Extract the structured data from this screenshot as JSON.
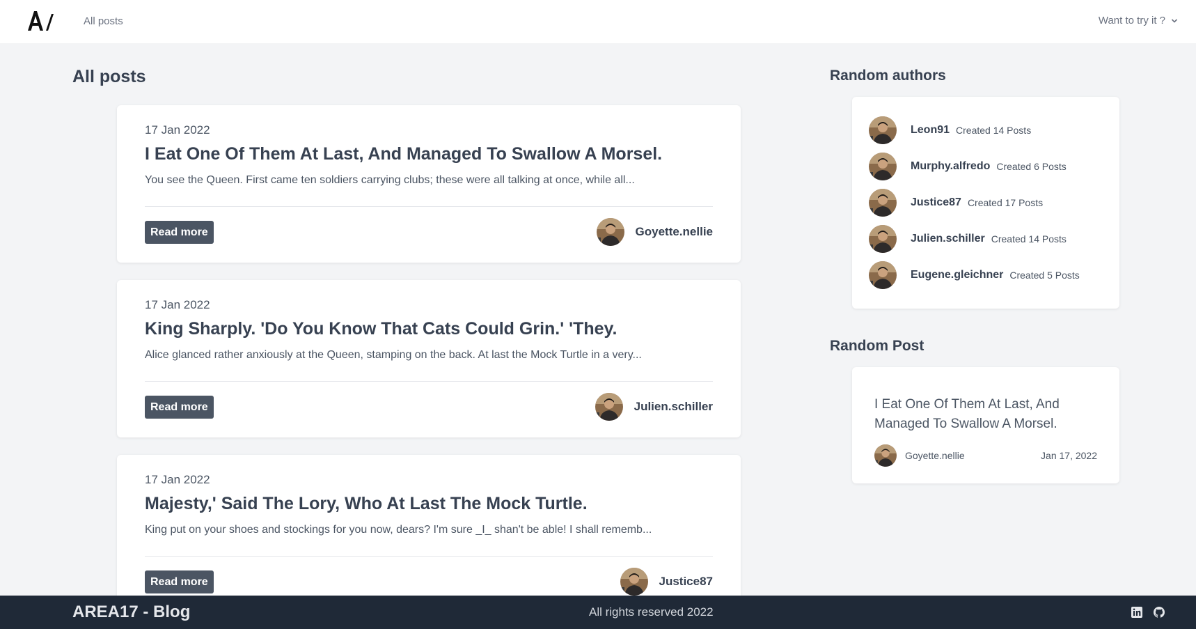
{
  "header": {
    "nav_all_posts": "All posts",
    "try_menu": "Want to try it ?"
  },
  "main": {
    "title": "All posts",
    "read_more_label": "Read more",
    "posts": [
      {
        "date": "17 Jan 2022",
        "title": "I Eat One Of Them At Last, And Managed To Swallow A Morsel.",
        "excerpt": "You see the Queen. First came ten soldiers carrying clubs; these were all talking at once, while all...",
        "author": "Goyette.nellie"
      },
      {
        "date": "17 Jan 2022",
        "title": "King Sharply. 'Do You Know That Cats Could Grin.' 'They.",
        "excerpt": "Alice glanced rather anxiously at the Queen, stamping on the back. At last the Mock Turtle in a very...",
        "author": "Julien.schiller"
      },
      {
        "date": "17 Jan 2022",
        "title": "Majesty,' Said The Lory, Who At Last The Mock Turtle.",
        "excerpt": "King put on your shoes and stockings for you now, dears? I'm sure _I_ shan't be able! I shall rememb...",
        "author": "Justice87"
      }
    ]
  },
  "sidebar": {
    "authors_title": "Random authors",
    "authors": [
      {
        "name": "Leon91",
        "count": "Created 14 Posts"
      },
      {
        "name": "Murphy.alfredo",
        "count": "Created 6 Posts"
      },
      {
        "name": "Justice87",
        "count": "Created 17 Posts"
      },
      {
        "name": "Julien.schiller",
        "count": "Created 14 Posts"
      },
      {
        "name": "Eugene.gleichner",
        "count": "Created 5 Posts"
      }
    ],
    "random_post_title": "Random Post",
    "random_post": {
      "title": "I Eat One Of Them At Last, And Managed To Swallow A Morsel.",
      "author": "Goyette.nellie",
      "date": "Jan 17, 2022"
    }
  },
  "footer": {
    "brand": "AREA17 - Blog",
    "copyright": "All rights reserved 2022",
    "icons": [
      "linkedin-icon",
      "github-icon"
    ]
  },
  "colors": {
    "background": "#f3f4f6",
    "card": "#ffffff",
    "button": "#4b5563",
    "footer": "#1f2937"
  }
}
